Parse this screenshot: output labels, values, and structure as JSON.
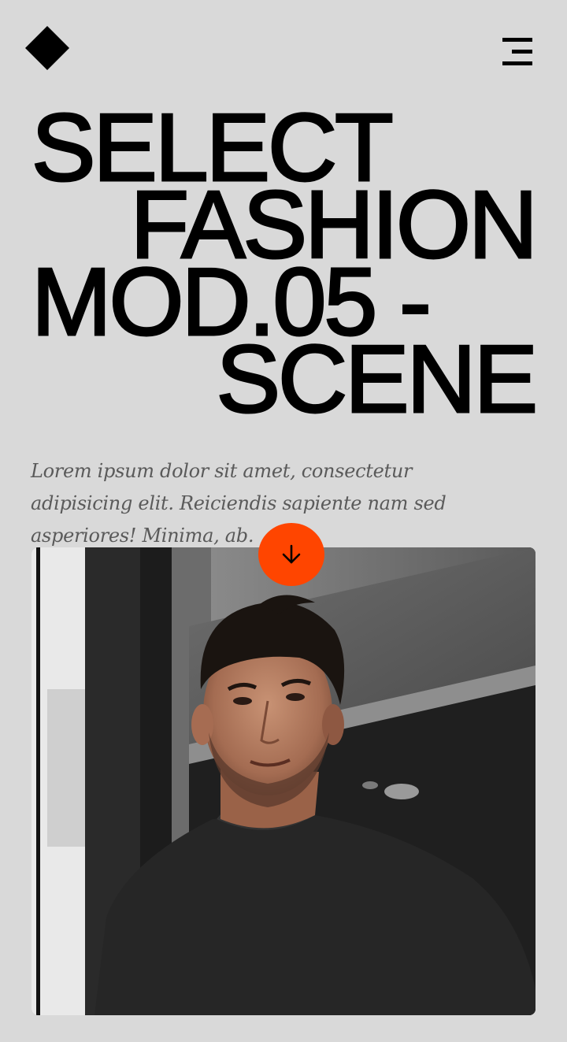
{
  "header": {
    "logo_icon": "diamond-icon",
    "menu_icon": "hamburger-menu-icon"
  },
  "hero": {
    "headline": {
      "line1": "SELECT",
      "line2": "FASHION",
      "line3": "MOD.05 -",
      "line4": "SCENE"
    },
    "tagline": "Lorem ipsum dolor sit amet, consectetur adipisicing elit. Reiciendis sapiente nam sed asperiores! Minima, ab."
  },
  "scroll_button": {
    "icon": "arrow-down-icon",
    "color": "#ff4500"
  },
  "colors": {
    "background": "#d9d9d9",
    "text": "#000000",
    "accent": "#ff4500"
  }
}
